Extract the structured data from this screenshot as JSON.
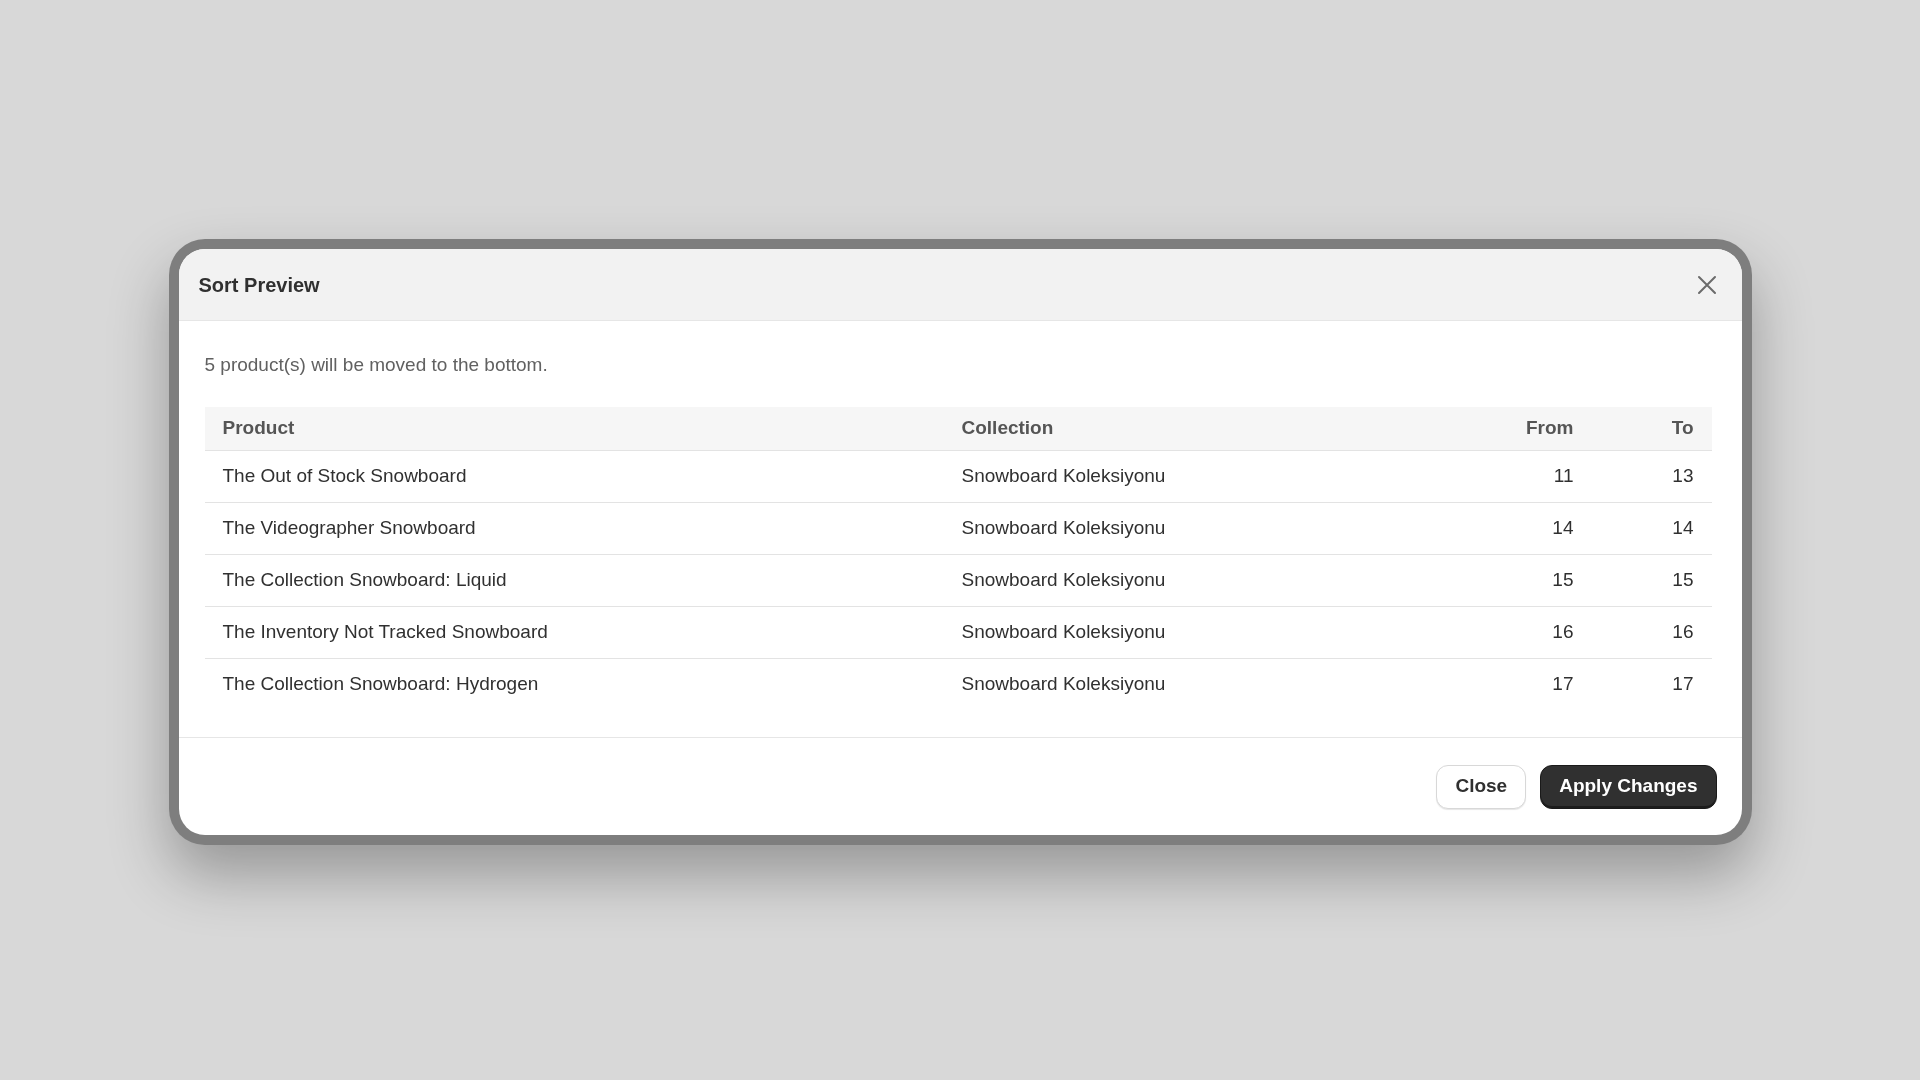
{
  "dialog": {
    "title": "Sort Preview",
    "message": "5 product(s) will be moved to the bottom.",
    "table": {
      "columns": [
        {
          "label": "Product",
          "numeric": false
        },
        {
          "label": "Collection",
          "numeric": false
        },
        {
          "label": "From",
          "numeric": true
        },
        {
          "label": "To",
          "numeric": true
        }
      ],
      "rows": [
        {
          "product": "The Out of Stock Snowboard",
          "collection": "Snowboard Koleksiyonu",
          "from": "11",
          "to": "13"
        },
        {
          "product": "The Videographer Snowboard",
          "collection": "Snowboard Koleksiyonu",
          "from": "14",
          "to": "14"
        },
        {
          "product": "The Collection Snowboard: Liquid",
          "collection": "Snowboard Koleksiyonu",
          "from": "15",
          "to": "15"
        },
        {
          "product": "The Inventory Not Tracked Snowboard",
          "collection": "Snowboard Koleksiyonu",
          "from": "16",
          "to": "16"
        },
        {
          "product": "The Collection Snowboard: Hydrogen",
          "collection": "Snowboard Koleksiyonu",
          "from": "17",
          "to": "17"
        }
      ]
    },
    "buttons": [
      {
        "label": "Close",
        "kind": "secondary"
      },
      {
        "label": "Apply Changes",
        "kind": "primary"
      }
    ]
  }
}
